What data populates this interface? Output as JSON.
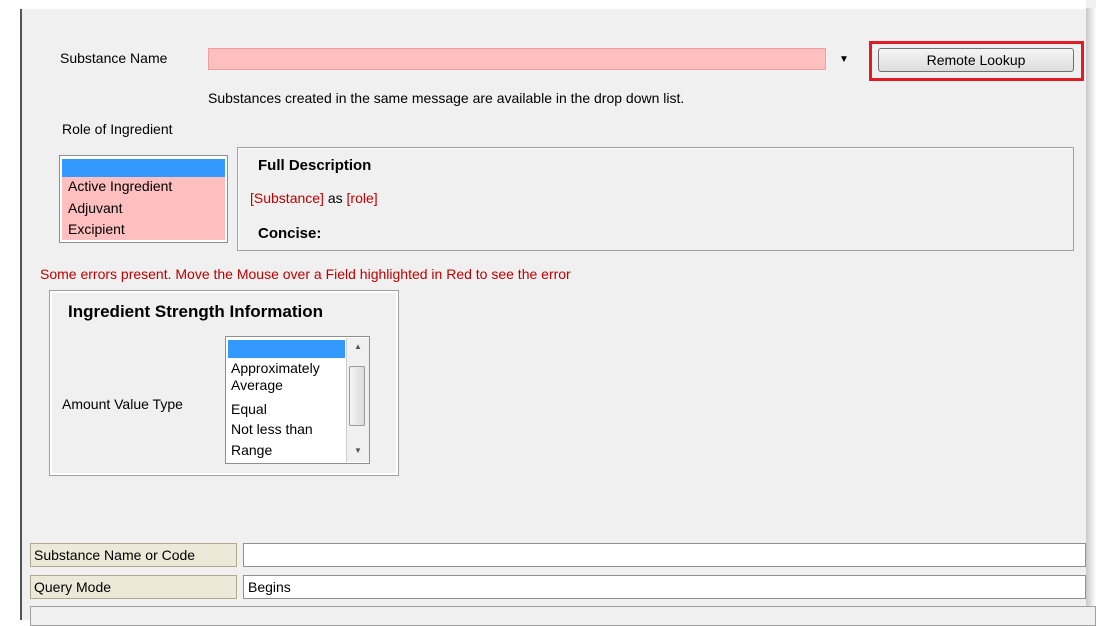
{
  "substance": {
    "label": "Substance Name",
    "value": "",
    "hint": "Substances created in the same message are available in the drop down list.",
    "remote_lookup_label": "Remote Lookup"
  },
  "role": {
    "label": "Role of Ingredient",
    "options": [
      "",
      "Active Ingredient",
      "Adjuvant",
      "Excipient"
    ]
  },
  "description": {
    "title": "Full Description",
    "substance_token": "[Substance]",
    "as_text": "as",
    "role_token": "[role]",
    "concise_label": "Concise:"
  },
  "error_message": "Some errors present. Move the Mouse over a Field highlighted in Red to see the error",
  "strength": {
    "title": "Ingredient Strength Information",
    "amount_value_type_label": "Amount Value Type",
    "options": [
      "",
      "Approximately",
      "Average",
      "Equal",
      "Not less than",
      "Range"
    ]
  },
  "query": {
    "name_or_code_label": "Substance Name or Code",
    "name_or_code_value": "",
    "mode_label": "Query Mode",
    "mode_value": "Begins"
  },
  "colors": {
    "error_red": "#c00000",
    "invalid_field_pink": "#ffbfbf",
    "selection_blue": "#3399ff",
    "highlight_red": "#e21c24"
  }
}
